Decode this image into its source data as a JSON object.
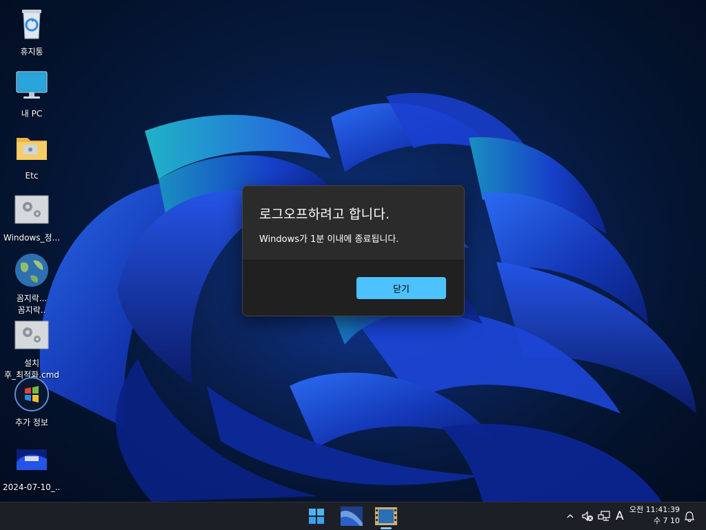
{
  "desktop": {
    "icons": [
      {
        "label": "휴지통",
        "icon": "recycle-bin-icon"
      },
      {
        "label": "내 PC",
        "icon": "monitor-icon"
      },
      {
        "label": "Etc",
        "icon": "folder-icon"
      },
      {
        "label": "Windows_정...",
        "icon": "settings-gear-icon"
      },
      {
        "label": "꼼지락...\n꼼지락..",
        "icon": "globe-icon"
      },
      {
        "label": "설치\n후_최적화.cmd",
        "icon": "settings-gear-icon"
      },
      {
        "label": "추가 정보",
        "icon": "windows-orb-icon"
      },
      {
        "label": "2024-07-10_...",
        "icon": "screenshot-image-icon"
      }
    ]
  },
  "dialog": {
    "title": "로그오프하려고 합니다.",
    "message": "Windows가 1분 이내에 종료됩니다.",
    "close_label": "닫기"
  },
  "taskbar": {
    "apps": [
      "windows-start-icon",
      "wallpaper-app-icon",
      "film-app-icon"
    ],
    "tray": {
      "chevron": "chevron-up-icon",
      "speaker": "speaker-muted-icon",
      "network": "network-disconnected-icon",
      "ime": "A"
    },
    "clock": {
      "time": "오전 11:41:39",
      "date": "수 7 10"
    }
  },
  "colors": {
    "accent": "#4cc2ff",
    "dialog_bg": "#2b2b2b",
    "dialog_footer": "#202020",
    "taskbar_bg": "#1c2026"
  }
}
